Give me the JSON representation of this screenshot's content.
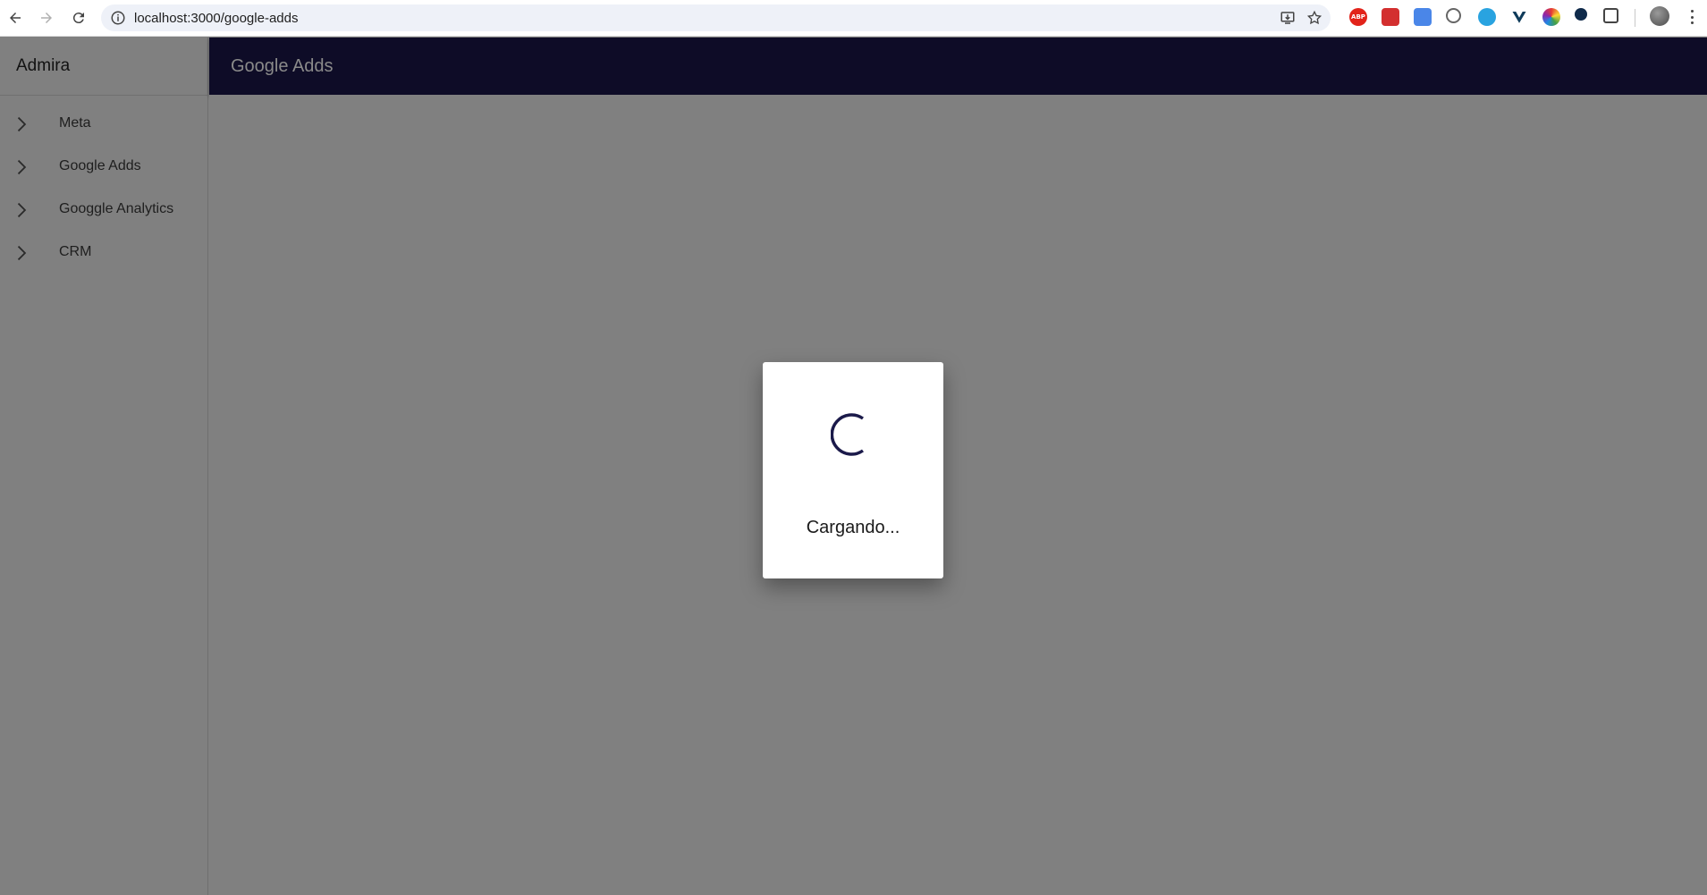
{
  "browser": {
    "url": "localhost:3000/google-adds",
    "extensions": [
      {
        "name": "adblock-plus-icon",
        "text": "ABP",
        "color": "#e2231a"
      },
      {
        "name": "pdf-extension-icon",
        "text": "",
        "color": "#d32f2f"
      },
      {
        "name": "translate-icon",
        "text": "",
        "color": "#4a86e8"
      },
      {
        "name": "wappalyzer-icon",
        "text": "",
        "color": "#666666"
      },
      {
        "name": "quick-edit-icon",
        "text": "",
        "color": "#29a3e0"
      },
      {
        "name": "vuejs-devtools-icon",
        "text": "",
        "color": "#0e3b5a"
      },
      {
        "name": "color-picker-icon",
        "text": "",
        "color": "#e53935"
      },
      {
        "name": "react-devtools-icon",
        "text": "",
        "color": "#0f2a4a"
      },
      {
        "name": "extensions-puzzle-icon",
        "text": "",
        "color": "#444444"
      }
    ]
  },
  "app": {
    "brand": "Admira",
    "page_title": "Google Adds",
    "accent_color": "#0e0c27"
  },
  "sidebar": {
    "items": [
      {
        "label": "Meta"
      },
      {
        "label": "Google Adds"
      },
      {
        "label": "Googgle Analytics"
      },
      {
        "label": "CRM"
      }
    ]
  },
  "modal": {
    "loading_text": "Cargando...",
    "spinner_color": "#1b1a4a"
  }
}
